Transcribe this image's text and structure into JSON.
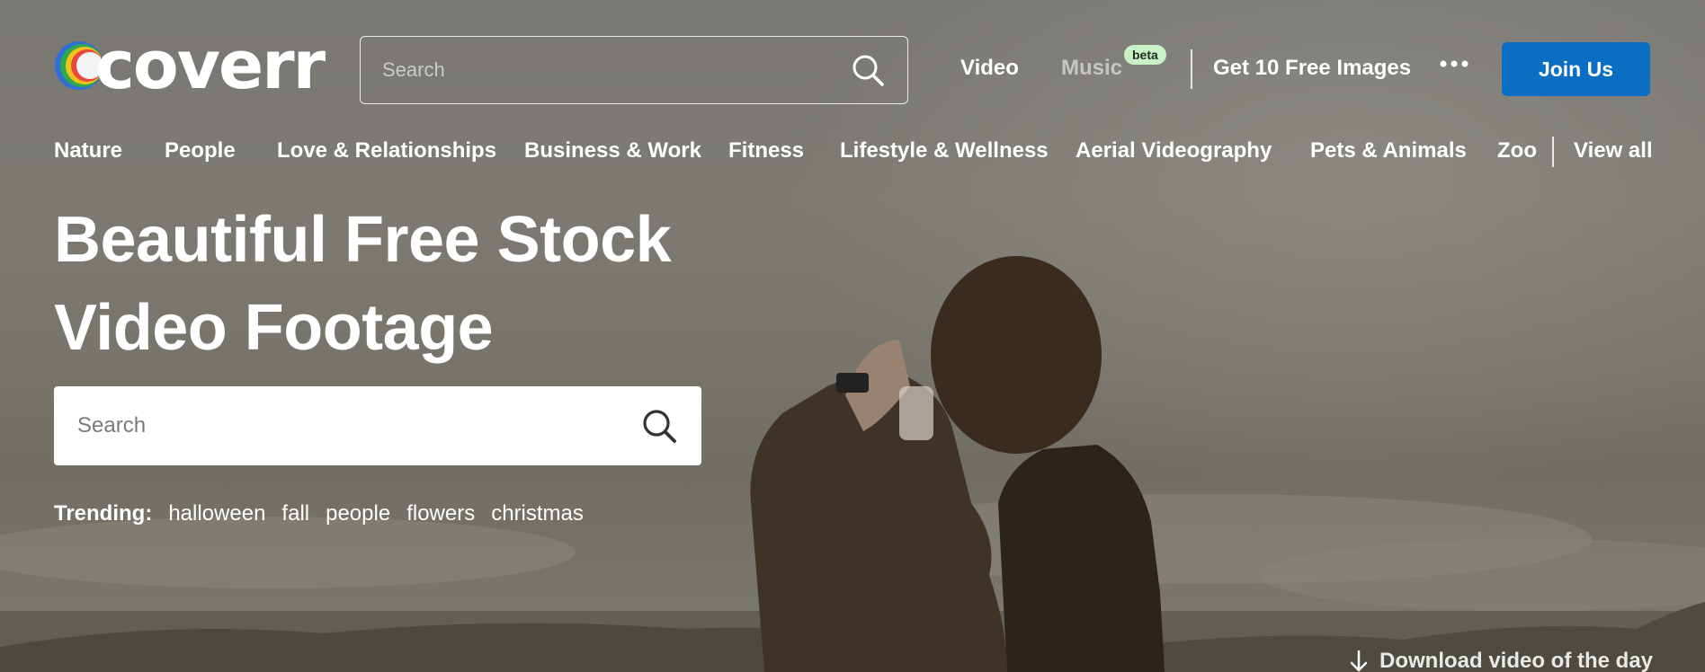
{
  "brand": {
    "name": "coverr"
  },
  "header": {
    "search_placeholder": "Search",
    "nav": {
      "video": "Video",
      "music": "Music",
      "music_badge": "beta",
      "images": "Get 10 Free Images"
    },
    "join_label": "Join Us"
  },
  "categories": [
    "Nature",
    "People",
    "Love & Relationships",
    "Business & Work",
    "Fitness",
    "Lifestyle & Wellness",
    "Aerial Videography",
    "Pets & Animals",
    "Zoo"
  ],
  "view_all": "View all",
  "hero": {
    "title_line1": "Beautiful Free Stock",
    "title_line2": "Video Footage",
    "search_placeholder": "Search",
    "trending_label": "Trending:",
    "trending": [
      "halloween",
      "fall",
      "people",
      "flowers",
      "christmas"
    ],
    "download_label": "Download video of the day"
  },
  "colors": {
    "primary": "#0a6fc2",
    "badge": "#c9f2c6"
  },
  "icons": {
    "search": "search-icon",
    "more": "more-dots-icon",
    "download": "arrow-down-icon"
  }
}
